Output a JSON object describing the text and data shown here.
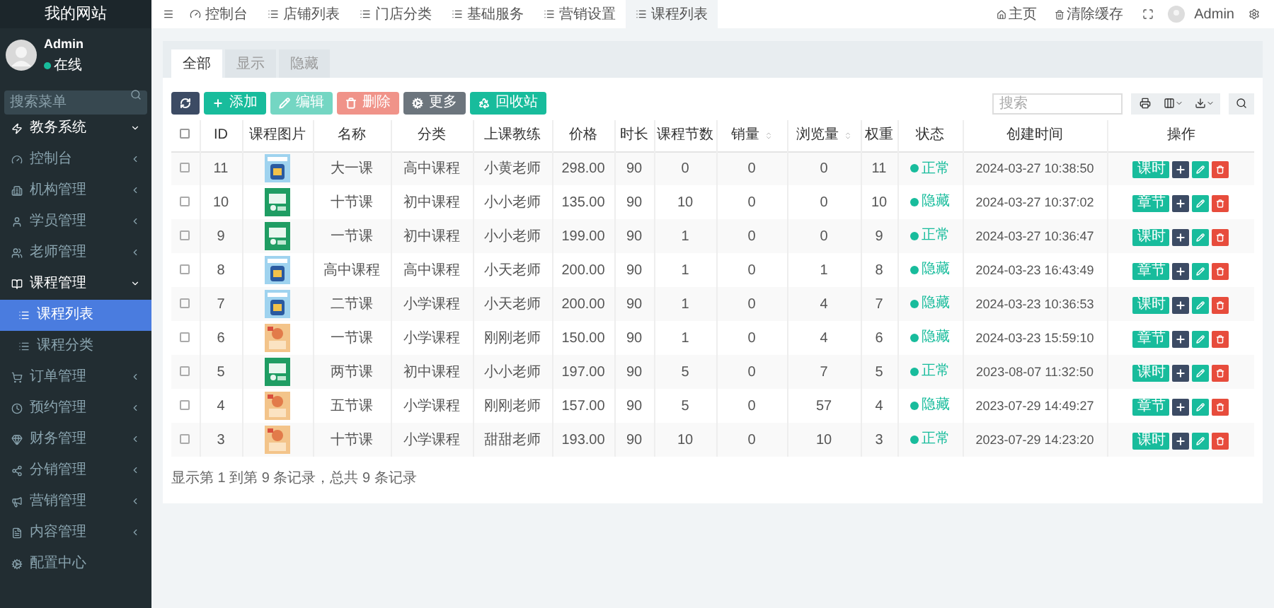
{
  "brand": "我的网站",
  "user": {
    "name": "Admin",
    "status": "在线"
  },
  "sidebar_search": {
    "placeholder": "搜索菜单"
  },
  "sidebar": {
    "items": [
      {
        "label": "教务系统",
        "expanded": true,
        "selected": false,
        "kind": "header"
      },
      {
        "label": "控制台",
        "expanded": false,
        "selected": false,
        "kind": "item"
      },
      {
        "label": "机构管理",
        "expanded": false,
        "selected": false,
        "kind": "item"
      },
      {
        "label": "学员管理",
        "expanded": false,
        "selected": false,
        "kind": "item"
      },
      {
        "label": "老师管理",
        "expanded": false,
        "selected": false,
        "kind": "item"
      },
      {
        "label": "课程管理",
        "expanded": true,
        "selected": false,
        "kind": "item",
        "children": [
          {
            "label": "课程列表",
            "selected": true
          },
          {
            "label": "课程分类",
            "selected": false
          }
        ]
      },
      {
        "label": "订单管理",
        "expanded": false,
        "selected": false,
        "kind": "item"
      },
      {
        "label": "预约管理",
        "expanded": false,
        "selected": false,
        "kind": "item"
      },
      {
        "label": "财务管理",
        "expanded": false,
        "selected": false,
        "kind": "item"
      },
      {
        "label": "分销管理",
        "expanded": false,
        "selected": false,
        "kind": "item"
      },
      {
        "label": "营销管理",
        "expanded": false,
        "selected": false,
        "kind": "item"
      },
      {
        "label": "内容管理",
        "expanded": false,
        "selected": false,
        "kind": "item"
      },
      {
        "label": "配置中心",
        "expanded": false,
        "selected": false,
        "kind": "leaf"
      }
    ]
  },
  "top_tabs": [
    {
      "label": "控制台",
      "selected": false
    },
    {
      "label": "店铺列表",
      "selected": false
    },
    {
      "label": "门店分类",
      "selected": false
    },
    {
      "label": "基础服务",
      "selected": false
    },
    {
      "label": "营销设置",
      "selected": false
    },
    {
      "label": "课程列表",
      "selected": true
    }
  ],
  "top_right": {
    "home": "主页",
    "clear_cache": "清除缓存",
    "user": "Admin"
  },
  "filter_tabs": [
    {
      "label": "全部",
      "selected": true
    },
    {
      "label": "显示",
      "selected": false
    },
    {
      "label": "隐藏",
      "selected": false
    }
  ],
  "toolbar": [
    {
      "kind": "refresh",
      "disabled": false
    },
    {
      "kind": "add",
      "label": "添加",
      "disabled": false
    },
    {
      "kind": "edit",
      "label": "编辑",
      "disabled": true
    },
    {
      "kind": "delete",
      "label": "删除",
      "disabled": true
    },
    {
      "kind": "more",
      "label": "更多",
      "disabled": false
    },
    {
      "kind": "recycle",
      "label": "回收站",
      "disabled": false
    }
  ],
  "table_search": {
    "placeholder": "搜索"
  },
  "table": {
    "select_all": {
      "checked": false
    },
    "columns": [
      {
        "label": "ID",
        "sortable": false
      },
      {
        "label": "课程图片",
        "sortable": false
      },
      {
        "label": "名称",
        "sortable": false
      },
      {
        "label": "分类",
        "sortable": false
      },
      {
        "label": "上课教练",
        "sortable": false
      },
      {
        "label": "价格",
        "sortable": false
      },
      {
        "label": "时长",
        "sortable": false
      },
      {
        "label": "课程节数",
        "sortable": false
      },
      {
        "label": "销量",
        "sortable": true
      },
      {
        "label": "浏览量",
        "sortable": true
      },
      {
        "label": "权重",
        "sortable": false
      },
      {
        "label": "状态",
        "sortable": false
      },
      {
        "label": "创建时间",
        "sortable": false
      },
      {
        "label": "操作",
        "sortable": false
      }
    ],
    "rows": [
      {
        "checked": false,
        "id": "11",
        "name": "大一课",
        "category": "高中课程",
        "teacher": "小黄老师",
        "price": "298.00",
        "duration": "90",
        "lessons": "0",
        "sales": "0",
        "views": "0",
        "weight": "11",
        "status": "正常",
        "created": "2024-03-27 10:38:50",
        "action": "课时"
      },
      {
        "checked": false,
        "id": "10",
        "name": "十节课",
        "category": "初中课程",
        "teacher": "小小老师",
        "price": "135.00",
        "duration": "90",
        "lessons": "10",
        "sales": "0",
        "views": "0",
        "weight": "10",
        "status": "隐藏",
        "created": "2024-03-27 10:37:02",
        "action": "章节"
      },
      {
        "checked": false,
        "id": "9",
        "name": "一节课",
        "category": "初中课程",
        "teacher": "小小老师",
        "price": "199.00",
        "duration": "90",
        "lessons": "1",
        "sales": "0",
        "views": "0",
        "weight": "9",
        "status": "正常",
        "created": "2024-03-27 10:36:47",
        "action": "课时"
      },
      {
        "checked": false,
        "id": "8",
        "name": "高中课程",
        "category": "高中课程",
        "teacher": "小天老师",
        "price": "200.00",
        "duration": "90",
        "lessons": "1",
        "sales": "0",
        "views": "1",
        "weight": "8",
        "status": "隐藏",
        "created": "2024-03-23 16:43:49",
        "action": "章节"
      },
      {
        "checked": false,
        "id": "7",
        "name": "二节课",
        "category": "小学课程",
        "teacher": "小天老师",
        "price": "200.00",
        "duration": "90",
        "lessons": "1",
        "sales": "0",
        "views": "4",
        "weight": "7",
        "status": "隐藏",
        "created": "2024-03-23 10:36:53",
        "action": "课时"
      },
      {
        "checked": false,
        "id": "6",
        "name": "一节课",
        "category": "小学课程",
        "teacher": "刚刚老师",
        "price": "150.00",
        "duration": "90",
        "lessons": "1",
        "sales": "0",
        "views": "4",
        "weight": "6",
        "status": "隐藏",
        "created": "2024-03-23 15:59:10",
        "action": "章节"
      },
      {
        "checked": false,
        "id": "5",
        "name": "两节课",
        "category": "初中课程",
        "teacher": "小小老师",
        "price": "197.00",
        "duration": "90",
        "lessons": "5",
        "sales": "0",
        "views": "7",
        "weight": "5",
        "status": "正常",
        "created": "2023-08-07 11:32:50",
        "action": "课时"
      },
      {
        "checked": false,
        "id": "4",
        "name": "五节课",
        "category": "小学课程",
        "teacher": "刚刚老师",
        "price": "157.00",
        "duration": "90",
        "lessons": "5",
        "sales": "0",
        "views": "57",
        "weight": "4",
        "status": "隐藏",
        "created": "2023-07-29 14:49:27",
        "action": "章节"
      },
      {
        "checked": false,
        "id": "3",
        "name": "十节课",
        "category": "小学课程",
        "teacher": "甜甜老师",
        "price": "193.00",
        "duration": "90",
        "lessons": "10",
        "sales": "0",
        "views": "10",
        "weight": "3",
        "status": "正常",
        "created": "2023-07-29 14:23:20",
        "action": "课时"
      }
    ]
  },
  "pagination_info": "显示第 1 到第 9 条记录，总共 9 条记录"
}
